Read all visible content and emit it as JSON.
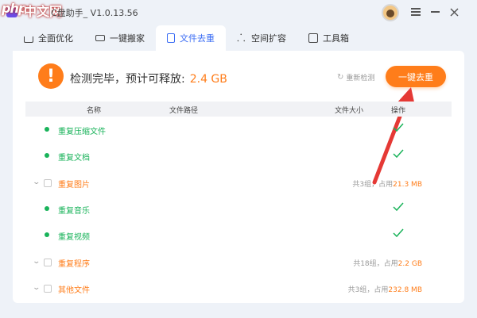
{
  "window": {
    "title": "C盘助手_ V1.0.13.56",
    "watermark_php": "php",
    "watermark_cn": "中文网"
  },
  "tabs": [
    {
      "label": "全面优化",
      "icon": "home-icon",
      "active": false
    },
    {
      "label": "一键搬家",
      "icon": "truck-icon",
      "active": false
    },
    {
      "label": "文件去重",
      "icon": "document-icon",
      "active": true
    },
    {
      "label": "空间扩容",
      "icon": "network-icon",
      "active": false
    },
    {
      "label": "工具箱",
      "icon": "toolbox-icon",
      "active": false
    }
  ],
  "status": {
    "text": "检测完毕，预计可释放:",
    "size": "2.4 GB",
    "icon": "warning-icon"
  },
  "actions": {
    "recheck_label": "重新检测",
    "dedupe_label": "一键去重"
  },
  "table": {
    "headers": {
      "name": "名称",
      "path": "文件路径",
      "size": "文件大小",
      "op": "操作"
    },
    "rows": [
      {
        "label": "重复压缩文件",
        "state": "done"
      },
      {
        "label": "重复文档",
        "state": "done"
      },
      {
        "label": "重复图片",
        "state": "pending",
        "prefix": "共",
        "groups": "3",
        "mid": "组，占用",
        "size": "21.3 MB"
      },
      {
        "label": "重复音乐",
        "state": "done"
      },
      {
        "label": "重复视频",
        "state": "done"
      },
      {
        "label": "重复程序",
        "state": "pending",
        "prefix": "共",
        "groups": "18",
        "mid": "组，占用",
        "size": "2.2 GB"
      },
      {
        "label": "其他文件",
        "state": "pending",
        "prefix": "共",
        "groups": "3",
        "mid": "组，占用",
        "size": "232.8 MB"
      }
    ]
  },
  "colors": {
    "accent_orange": "#ff7d1a",
    "done_green": "#19b35a",
    "tab_active_blue": "#3a6cf4",
    "arrow_red": "#e53935"
  }
}
